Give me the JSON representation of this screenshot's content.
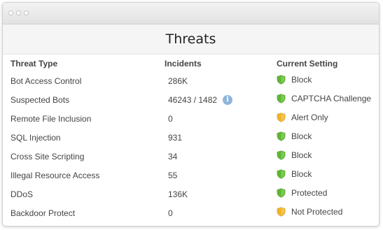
{
  "window": {
    "title": "Threats"
  },
  "table": {
    "headers": {
      "threat_type": "Threat Type",
      "incidents": "Incidents",
      "current_setting": "Current Setting"
    },
    "rows": [
      {
        "threat": "Bot Access Control",
        "incidents": "286K",
        "setting": "Block",
        "shield": "green-shield-icon",
        "info": false
      },
      {
        "threat": "Suspected Bots",
        "incidents": "46243 / 1482",
        "setting": "CAPTCHA Challenge",
        "shield": "green-shield-icon",
        "info": true
      },
      {
        "threat": "Remote File Inclusion",
        "incidents": "0",
        "setting": "Alert Only",
        "shield": "yellow-shield-icon",
        "info": false
      },
      {
        "threat": "SQL Injection",
        "incidents": "931",
        "setting": "Block",
        "shield": "green-shield-icon",
        "info": false
      },
      {
        "threat": "Cross Site Scripting",
        "incidents": "34",
        "setting": "Block",
        "shield": "green-shield-icon",
        "info": false
      },
      {
        "threat": "Illegal Resource Access",
        "incidents": "55",
        "setting": "Block",
        "shield": "green-shield-icon",
        "info": false
      },
      {
        "threat": "DDoS",
        "incidents": "136K",
        "setting": "Protected",
        "shield": "green-shield-icon",
        "info": false
      },
      {
        "threat": "Backdoor Protect",
        "incidents": "0",
        "setting": "Not Protected",
        "shield": "yellow-shield-icon",
        "info": false
      }
    ]
  },
  "colors": {
    "green_shield": "#5cb82e",
    "yellow_shield": "#f0b323",
    "info_icon": "#8fb6dc"
  },
  "icons": {
    "info": "info-icon"
  }
}
